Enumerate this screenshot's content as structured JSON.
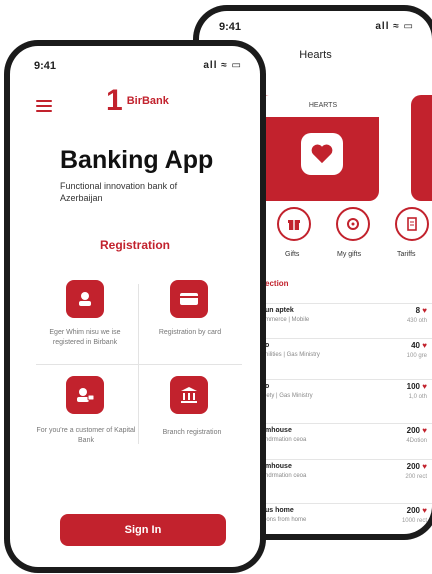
{
  "back_screen": {
    "time": "9:41",
    "signal": "all ≈ ▭",
    "title": "Hearts",
    "card_tab": "HEARTS",
    "actions": [
      {
        "label": "Gifts",
        "icon": "gift-icon"
      },
      {
        "label": "My gifts",
        "icon": "my-gifts-icon"
      },
      {
        "label": "Tariffs",
        "icon": "tariffs-icon"
      }
    ],
    "section_title": "ection",
    "rows": [
      {
        "name": "un aptek",
        "sub": "mmerce | Mobile",
        "amount": "8",
        "count": "430 oth"
      },
      {
        "name": "o",
        "sub": "nilities | Gas Ministry",
        "amount": "40",
        "count": "100 gre"
      },
      {
        "name": "o",
        "sub": "iety | Gas Ministry",
        "amount": "100",
        "count": "1,0 oth"
      },
      {
        "name": "mhouse",
        "sub": "ndrmation ceoa",
        "amount": "200",
        "count": "4Dotion"
      },
      {
        "name": "mhouse",
        "sub": "ndrmation ceoa",
        "amount": "200",
        "count": "200 rect"
      },
      {
        "name": "us home",
        "sub": "ions from home",
        "amount": "200",
        "count": "1000 rect"
      }
    ],
    "colors": {
      "accent": "#c2222d"
    }
  },
  "front_screen": {
    "time": "9:41",
    "signal": "all ≈ ▭",
    "logo_mark": "1",
    "logo_text": "BirBank",
    "title": "Banking App",
    "description": "Functional innovation bank of Azerbaijan",
    "registration": "Registration",
    "options": [
      {
        "label": "Eger Whim nisu we ise registered in Birbank",
        "icon": "user-icon"
      },
      {
        "label": "Registration by card",
        "icon": "card-icon"
      },
      {
        "label": "For you're a customer of Kapital Bank",
        "icon": "customer-icon"
      },
      {
        "label": "Branch registration",
        "icon": "bank-icon"
      }
    ],
    "signin": "Sign In"
  }
}
